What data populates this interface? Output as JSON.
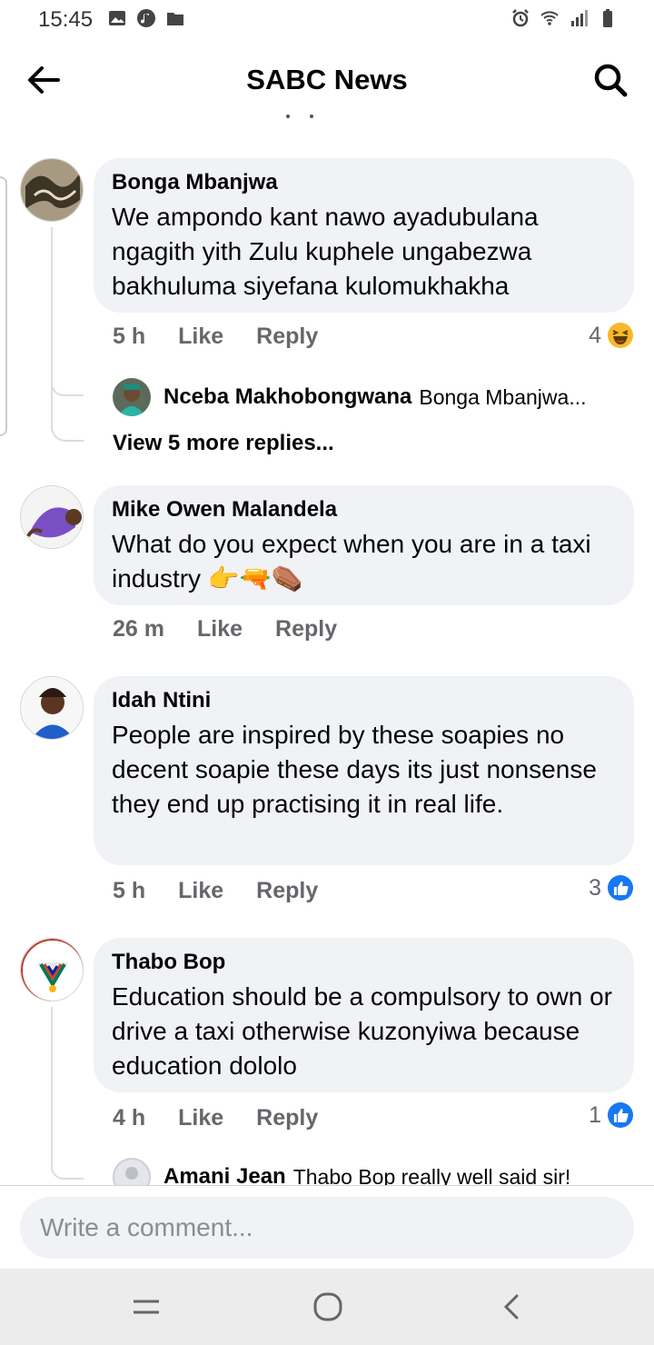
{
  "status_bar": {
    "time": "15:45",
    "left_icons": [
      "image-icon",
      "music-icon",
      "folder-icon"
    ],
    "right_icons": [
      "alarm-icon",
      "wifi-icon",
      "signal-icon",
      "battery-icon"
    ]
  },
  "app_bar": {
    "title": "SABC News",
    "back_icon": "arrow-left-icon",
    "search_icon": "search-icon"
  },
  "comments": [
    {
      "author": "Bonga Mbanjwa",
      "text": "We ampondo kant nawo ayadubulana ngagith yith Zulu kuphele ungabezwa bakhuluma siyefana kulomukhakha",
      "time": "5 h",
      "like": "Like",
      "reply": "Reply",
      "reaction_count": "4",
      "reaction_icon": "laugh-emoji-icon",
      "replies": [
        {
          "author": "Nceba Makhobongwana",
          "text": "Bonga Mbanjwa..."
        }
      ],
      "view_more": "View 5 more replies..."
    },
    {
      "author": "Mike Owen Malandela",
      "text": "What do you expect when you are in a taxi industry 👉🔫⚰️",
      "time": "26 m",
      "like": "Like",
      "reply": "Reply"
    },
    {
      "author": "Idah Ntini",
      "text": "People are inspired by these soapies no decent soapie these days its just nonsense they end up practising it in real life.",
      "time": "5 h",
      "like": "Like",
      "reply": "Reply",
      "reaction_count": "3",
      "reaction_icon": "thumbs-up-icon"
    },
    {
      "author": "Thabo Bop",
      "text": "Education should be a compulsory to own or drive a taxi otherwise kuzonyiwa because education dololo",
      "time": "4 h",
      "like": "Like",
      "reply": "Reply",
      "reaction_count": "1",
      "reaction_icon": "thumbs-up-icon",
      "replies": [
        {
          "author": "Amani Jean",
          "text": "Thabo Bop really well said sir!"
        }
      ]
    }
  ],
  "composer": {
    "placeholder": "Write a comment..."
  },
  "nav_bar": {
    "buttons": [
      "recent-apps-icon",
      "home-icon",
      "back-icon"
    ]
  },
  "colors": {
    "bubble": "#f0f2f5",
    "meta_text": "#65676b",
    "like_blue": "#1877f2"
  }
}
